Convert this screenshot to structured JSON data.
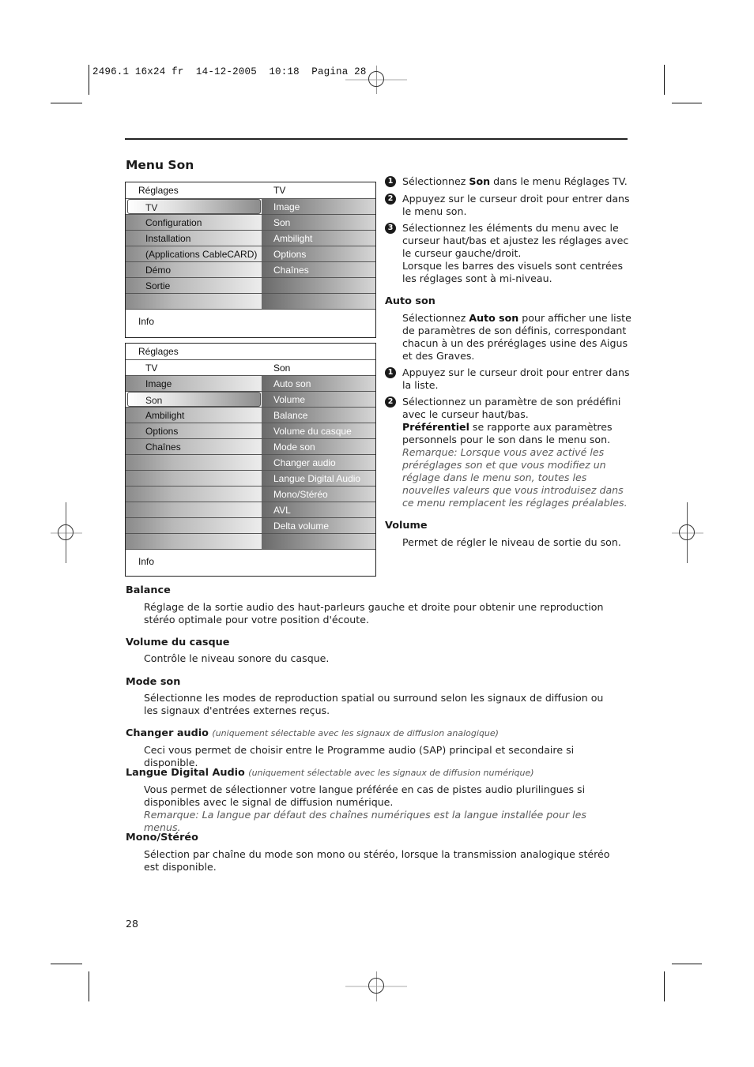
{
  "print_slug": "2496.1 16x24 fr  14-12-2005  10:18  Pagina 28",
  "page_title": "Menu Son",
  "menu1": {
    "header_left": "Réglages",
    "header_right": "TV",
    "rows": [
      {
        "left": "TV",
        "right": "Image",
        "selected": true
      },
      {
        "left": "Configuration",
        "right": "Son"
      },
      {
        "left": "Installation",
        "right": "Ambilight"
      },
      {
        "left": "(Applications CableCARD)",
        "right": "Options"
      },
      {
        "left": "Démo",
        "right": "Chaînes"
      },
      {
        "left": "Sortie",
        "right": ""
      },
      {
        "left": "",
        "right": ""
      }
    ],
    "info": "Info"
  },
  "menu2": {
    "header_left": "Réglages",
    "sub_left": "TV",
    "sub_right": "Son",
    "rows": [
      {
        "left": "Image",
        "right": "Auto son"
      },
      {
        "left": "Son",
        "right": "Volume",
        "selected": true
      },
      {
        "left": "Ambilight",
        "right": "Balance"
      },
      {
        "left": "Options",
        "right": "Volume du casque"
      },
      {
        "left": "Chaînes",
        "right": "Mode son"
      },
      {
        "left": "",
        "right": "Changer audio"
      },
      {
        "left": "",
        "right": "Langue Digital Audio"
      },
      {
        "left": "",
        "right": "Mono/Stéréo"
      },
      {
        "left": "",
        "right": "AVL"
      },
      {
        "left": "",
        "right": "Delta volume"
      },
      {
        "left": "",
        "right": ""
      }
    ],
    "info": "Info"
  },
  "steps": [
    {
      "num": "1",
      "pre": "Sélectionnez ",
      "bold": "Son",
      "post": " dans le menu Réglages TV."
    },
    {
      "num": "2",
      "text": "Appuyez sur le curseur droit pour entrer dans le menu son."
    },
    {
      "num": "3",
      "text": "Sélectionnez les éléments du menu avec le curseur haut/bas et ajustez les réglages avec le curseur gauche/droit.",
      "text2": "Lorsque les barres des visuels sont centrées les réglages sont à mi-niveau."
    }
  ],
  "auto_son": {
    "heading": "Auto son",
    "intro_pre": "Sélectionnez ",
    "intro_bold": "Auto son",
    "intro_post": " pour afficher une liste de paramètres de son définis, correspondant chacun à un des préréglages usine des Aigus et des Graves.",
    "step1_num": "1",
    "step1": "Appuyez sur le curseur droit pour entrer dans la liste.",
    "step2_num": "2",
    "step2": "Sélectionnez un paramètre de son prédéfini avec le curseur haut/bas.",
    "pref_bold": "Préférentiel",
    "pref_post": " se rapporte aux paramètres personnels pour le son dans le menu son.",
    "remark": "Remarque: Lorsque vous avez activé les préréglages son et que vous modifiez un réglage dans le menu son, toutes les nouvelles valeurs que vous introduisez dans ce menu remplacent les réglages préalables."
  },
  "volume": {
    "heading": "Volume",
    "text": "Permet de régler le niveau de sortie du son."
  },
  "sections": {
    "balance": {
      "heading": "Balance",
      "text": "Réglage de la sortie audio des haut-parleurs gauche et droite pour obtenir une reproduction stéréo optimale pour votre position d'écoute."
    },
    "casque": {
      "heading": "Volume du casque",
      "text": "Contrôle le niveau sonore du casque."
    },
    "mode": {
      "heading": "Mode son",
      "text": "Sélectionne les modes de reproduction spatial ou surround selon les signaux de diffusion ou les signaux d'entrées externes reçus."
    },
    "changer": {
      "heading": "Changer audio",
      "note": "(uniquement sélectable avec les signaux de diffusion analogique)",
      "text": "Ceci vous permet de choisir entre le Programme audio (SAP) principal et secondaire si disponible."
    },
    "langue": {
      "heading": "Langue Digital Audio",
      "note": "(uniquement sélectable avec les signaux de diffusion numérique)",
      "text": "Vous permet de sélectionner votre langue préférée en cas de pistes audio plurilingues si disponibles avec le signal de diffusion numérique.",
      "remark": "Remarque: La langue par défaut des chaînes numériques est la langue installée pour les menus."
    },
    "mono": {
      "heading": "Mono/Stéréo",
      "text": "Sélection par chaîne du mode son mono ou stéréo, lorsque la transmission analogique stéréo est disponible."
    }
  },
  "page_number": "28"
}
